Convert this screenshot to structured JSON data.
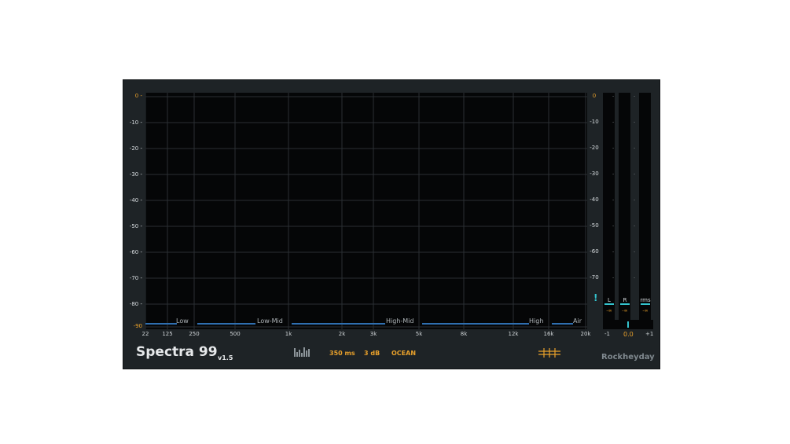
{
  "app": {
    "name": "Spectra 99",
    "version": "v1.5",
    "brand": "Rockheyday"
  },
  "toolbar": {
    "view_icon": "spectrum-bars-icon",
    "decay": "350 ms",
    "slope": "3 dB",
    "theme": "OCEAN",
    "grid_icon": "grid-icon"
  },
  "spectrum": {
    "db_labels": [
      "0 -",
      "-10 -",
      "-20 -",
      "-30 -",
      "-40 -",
      "-50 -",
      "-60 -",
      "-70 -",
      "-80 -",
      "-90"
    ],
    "freq_labels": [
      "22",
      "125",
      "250",
      "500",
      "1k",
      "2k",
      "3k",
      "5k",
      "8k",
      "12k",
      "16k",
      "20k"
    ],
    "bands": [
      "Low",
      "Low-Mid",
      "High-Mid",
      "High",
      "Air"
    ],
    "colors": {
      "accent": "#e9a12b",
      "band_line": "#2f6fb0",
      "grid": "#2a2f33"
    }
  },
  "meters": {
    "db_labels": [
      "0",
      "-10",
      "-20",
      "-30",
      "-40",
      "-50",
      "-60",
      "-70"
    ],
    "channels": [
      {
        "name": "L",
        "value": "-∞"
      },
      {
        "name": "R",
        "value": "-∞"
      },
      {
        "name": "rms",
        "value": "-∞"
      }
    ],
    "clip_indicator": "!",
    "balance": {
      "min": "-1",
      "max": "+1",
      "value": "0.0"
    },
    "colors": {
      "meter": "#34c3cd"
    }
  }
}
